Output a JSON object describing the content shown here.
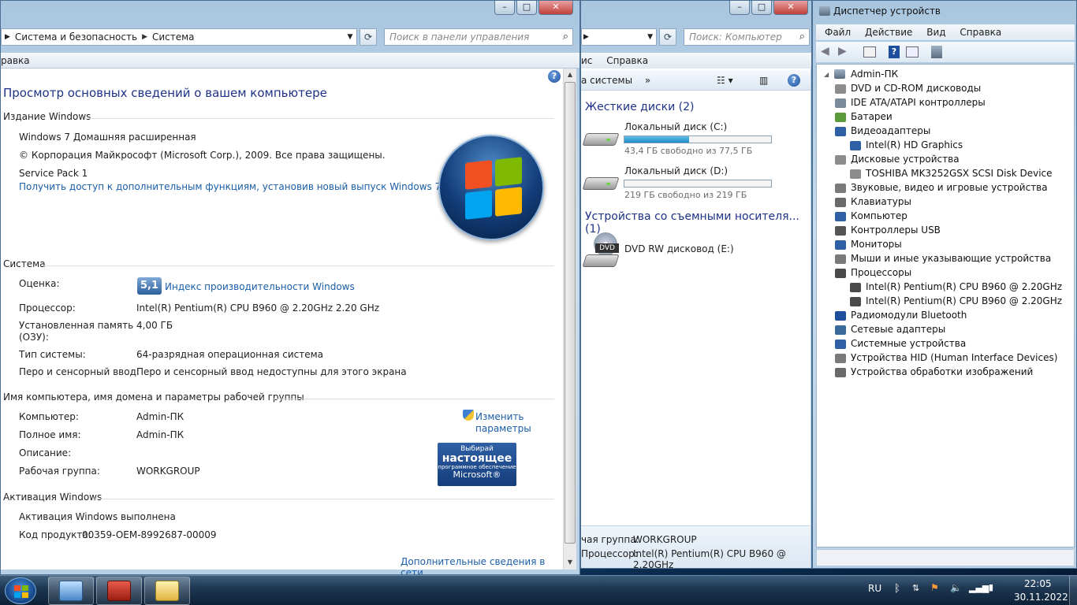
{
  "system_window": {
    "breadcrumb": [
      "Система и безопасность",
      "Система"
    ],
    "search_placeholder": "Поиск в панели управления",
    "menu_partial": "равка",
    "title": "Просмотр основных сведений о вашем компьютере",
    "edition": {
      "header": "Издание Windows",
      "name": "Windows 7 Домашняя расширенная",
      "copyright": "© Корпорация Майкрософт (Microsoft Corp.), 2009. Все права защищены.",
      "service_pack": "Service Pack 1",
      "upgrade_link": "Получить доступ к дополнительным функциям, установив новый выпуск Windows 7"
    },
    "system": {
      "header": "Система",
      "rating_label": "Оценка:",
      "rating_value": "5,1",
      "rating_link": "Индекс производительности Windows",
      "cpu_label": "Процессор:",
      "cpu_value": "Intel(R) Pentium(R) CPU B960 @ 2.20GHz   2.20 GHz",
      "ram_label_1": "Установленная память",
      "ram_label_2": "(ОЗУ):",
      "ram_value": "4,00 ГБ",
      "type_label": "Тип системы:",
      "type_value": "64-разрядная операционная система",
      "pen_label": "Перо и сенсорный ввод:",
      "pen_value": "Перо и сенсорный ввод недоступны для этого экрана"
    },
    "computer": {
      "header": "Имя компьютера, имя домена и параметры рабочей группы",
      "name_label": "Компьютер:",
      "name_value": "Admin-ПК",
      "full_label": "Полное имя:",
      "full_value": "Admin-ПК",
      "desc_label": "Описание:",
      "wg_label": "Рабочая группа:",
      "wg_value": "WORKGROUP",
      "change_1": "Изменить",
      "change_2": "параметры"
    },
    "activation": {
      "header": "Активация Windows",
      "status": "Активация Windows выполнена",
      "key_label": "Код продукта:",
      "key_value": "00359-OEM-8992687-00009",
      "more_link": "Дополнительные сведения в сети...",
      "genuine_1": "Выбирай",
      "genuine_2": "настоящее",
      "genuine_3": "программное обеспечение",
      "genuine_4": "Microsoft®"
    }
  },
  "explorer_window": {
    "search_placeholder": "Поиск: Компьютер",
    "menu_partial": "ис",
    "menu_help": "Справка",
    "toolbar_partial": "а системы",
    "toolbar_more": "»",
    "hdd_group": "Жесткие диски (2)",
    "drives": [
      {
        "name": "Локальный диск (C:)",
        "free": "43,4 ГБ свободно из 77,5 ГБ",
        "used_fraction": 0.44
      },
      {
        "name": "Локальный диск (D:)",
        "free": "219 ГБ свободно из 219 ГБ",
        "used_fraction": 0.0
      }
    ],
    "removable_group": "Устройства со съемными носителя... (1)",
    "dvd_name": "DVD RW дисковод (E:)",
    "dvd_label": "DVD",
    "details_wg_label": "чая группа:",
    "details_wg_value": "WORKGROUP",
    "details_cpu_label": "Процессор:",
    "details_cpu_value": "Intel(R) Pentium(R) CPU B960 @ 2.20GHz"
  },
  "device_manager": {
    "title": "Диспетчер устройств",
    "menu": [
      "Файл",
      "Действие",
      "Вид",
      "Справка"
    ],
    "root": "Admin-ПК",
    "nodes": [
      {
        "label": "DVD и CD-ROM дисководы",
        "state": "collapsed",
        "icon_color": "#8c8c8c"
      },
      {
        "label": "IDE ATA/ATAPI контроллеры",
        "state": "collapsed",
        "icon_color": "#7a8a9a"
      },
      {
        "label": "Батареи",
        "state": "collapsed",
        "icon_color": "#5a9a3a"
      },
      {
        "label": "Видеоадаптеры",
        "state": "expanded",
        "icon_color": "#2f5fa5"
      },
      {
        "label": "Intel(R) HD Graphics",
        "state": "child",
        "icon_color": "#2f5fa5"
      },
      {
        "label": "Дисковые устройства",
        "state": "expanded",
        "icon_color": "#8c8c8c"
      },
      {
        "label": "TOSHIBA MK3252GSX SCSI Disk Device",
        "state": "child",
        "icon_color": "#8c8c8c"
      },
      {
        "label": "Звуковые, видео и игровые устройства",
        "state": "collapsed",
        "icon_color": "#7a7a7a"
      },
      {
        "label": "Клавиатуры",
        "state": "collapsed",
        "icon_color": "#6a6a6a"
      },
      {
        "label": "Компьютер",
        "state": "collapsed",
        "icon_color": "#2f5fa5"
      },
      {
        "label": "Контроллеры USB",
        "state": "collapsed",
        "icon_color": "#555555"
      },
      {
        "label": "Мониторы",
        "state": "collapsed",
        "icon_color": "#2f5fa5"
      },
      {
        "label": "Мыши и иные указывающие устройства",
        "state": "collapsed",
        "icon_color": "#7a7a7a"
      },
      {
        "label": "Процессоры",
        "state": "expanded",
        "icon_color": "#4a4a4a"
      },
      {
        "label": "Intel(R) Pentium(R) CPU B960 @ 2.20GHz",
        "state": "child",
        "icon_color": "#4a4a4a"
      },
      {
        "label": "Intel(R) Pentium(R) CPU B960 @ 2.20GHz",
        "state": "child",
        "icon_color": "#4a4a4a"
      },
      {
        "label": "Радиомодули Bluetooth",
        "state": "collapsed",
        "icon_color": "#1d4f9c"
      },
      {
        "label": "Сетевые адаптеры",
        "state": "collapsed",
        "icon_color": "#3a6a9a"
      },
      {
        "label": "Системные устройства",
        "state": "collapsed",
        "icon_color": "#2f5fa5"
      },
      {
        "label": "Устройства HID (Human Interface Devices)",
        "state": "collapsed",
        "icon_color": "#7a7a7a"
      },
      {
        "label": "Устройства обработки изображений",
        "state": "collapsed",
        "icon_color": "#6a6a6a"
      }
    ]
  },
  "taskbar": {
    "language": "RU",
    "time": "22:05",
    "date": "30.11.2022"
  },
  "colors": {
    "link": "#1a5ea8",
    "heading": "#1e3287",
    "drive_bar": "#1d8ac4"
  }
}
